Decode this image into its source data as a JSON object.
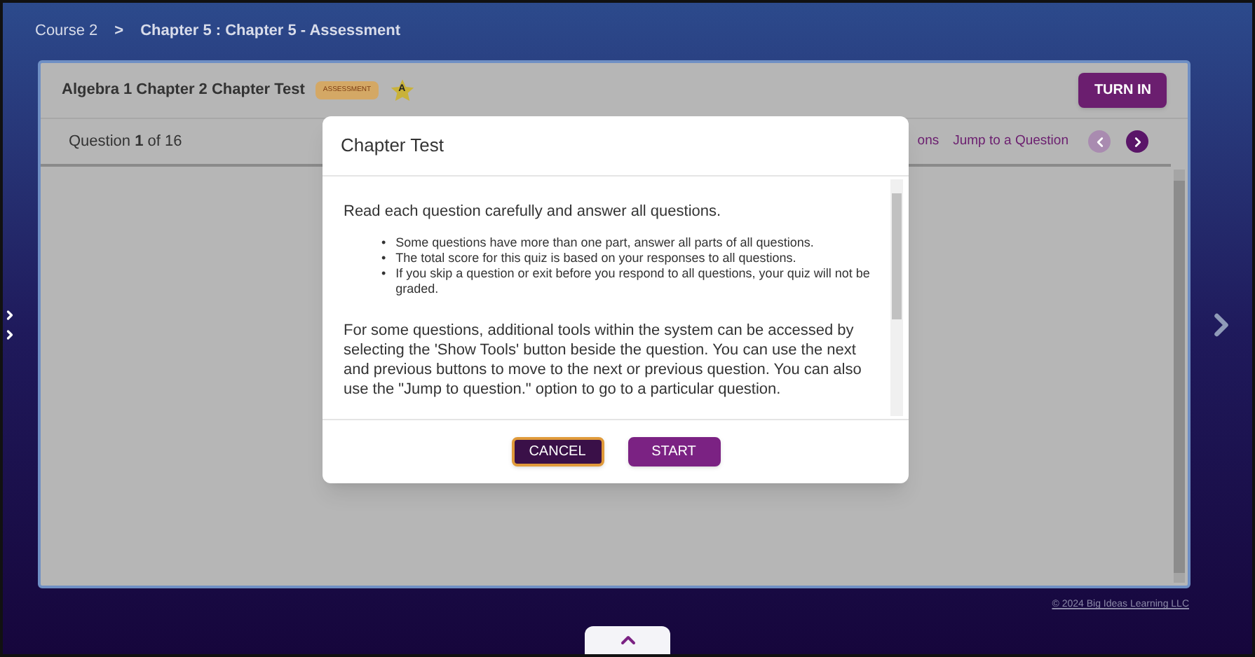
{
  "breadcrumb": [
    "Course 2",
    "Chapter 5 : Chapter 5 - Assessment"
  ],
  "breadcrumb_separator": ">",
  "assignment": {
    "title": "Algebra 1 Chapter 2 Chapter Test",
    "badge": "ASSESSMENT",
    "star_letter": "A",
    "turn_in": "TURN IN"
  },
  "question_bar": {
    "question_label": "Question",
    "question_number": "1",
    "of_label": "of 16",
    "links": [
      "ons",
      "Jump to a Question"
    ],
    "prev_disabled": true,
    "next_disabled": false
  },
  "dialog": {
    "title": "Chapter Test",
    "intro": "Read each question carefully and answer all questions.",
    "bullet_marker": "•",
    "bullets": [
      "Some questions have more than one part, answer all parts of all questions.",
      "The total score for this quiz is based on your responses to all questions.",
      "If you skip a question or exit before you respond to all questions, your quiz will not be graded."
    ],
    "paragraph": "For some questions, additional tools within the system can be accessed by selecting the 'Show Tools' button beside the question. You can use the next and previous buttons to move to the next or previous question. You can also use the \"Jump to question.\" option to go to a particular question.",
    "buttons": [
      {
        "label": "CANCEL",
        "kind": "secondary"
      },
      {
        "label": "START",
        "kind": "primary"
      }
    ]
  },
  "copyright": "© 2024 Big Ideas Learning LLC"
}
